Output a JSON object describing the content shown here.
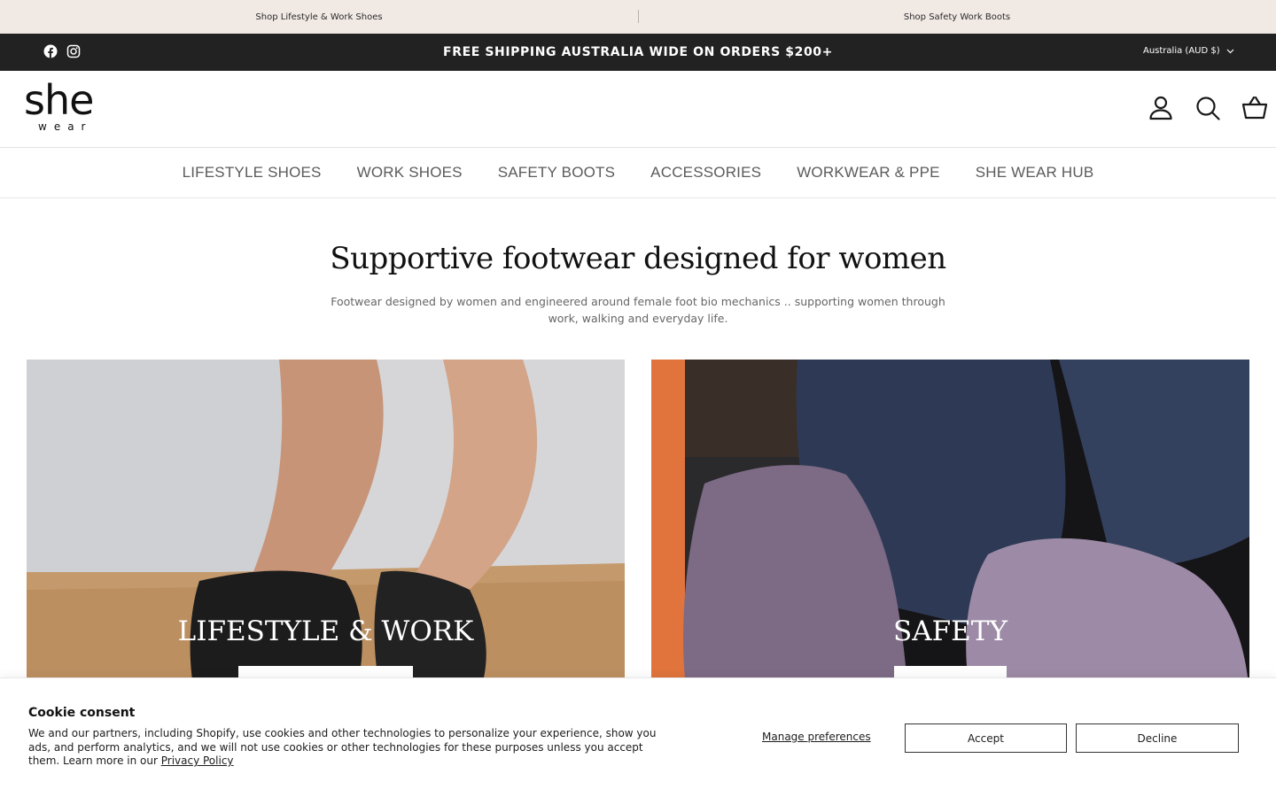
{
  "promo_bar": {
    "left_link": "Shop Lifestyle & Work Shoes",
    "right_link": "Shop Safety Work Boots"
  },
  "announcement": {
    "text": "FREE SHIPPING AUSTRALIA WIDE ON ORDERS $200+",
    "currency": "Australia (AUD $)",
    "social_icons": [
      "facebook-icon",
      "instagram-icon"
    ]
  },
  "header": {
    "logo_main": "she",
    "logo_sub": "wear",
    "icons": [
      "account-icon",
      "search-icon",
      "cart-basket-icon"
    ]
  },
  "nav": {
    "items": [
      "LIFESTYLE SHOES",
      "WORK SHOES",
      "SAFETY BOOTS",
      "ACCESSORIES",
      "WORKWEAR & PPE",
      "SHE WEAR HUB"
    ]
  },
  "hero": {
    "title": "Supportive footwear designed for women",
    "subtitle": "Footwear designed by women and engineered around female foot bio mechanics .. supporting women through work, walking and everyday life."
  },
  "tiles": [
    {
      "title": "LIFESTYLE & WORK"
    },
    {
      "title": "SAFETY"
    }
  ],
  "cookie": {
    "title": "Cookie consent",
    "text": "We and our partners, including Shopify, use cookies and other technologies to personalize your experience, show you ads, and perform analytics, and we will not use cookies or other technologies for these purposes unless you accept them. Learn more in our",
    "privacy_link": "Privacy Policy",
    "manage": "Manage preferences",
    "accept": "Accept",
    "decline": "Decline"
  },
  "colors": {
    "promo_bg": "#f1e9e4",
    "announce_bg": "#222222",
    "nav_text": "#5b5b5b"
  }
}
